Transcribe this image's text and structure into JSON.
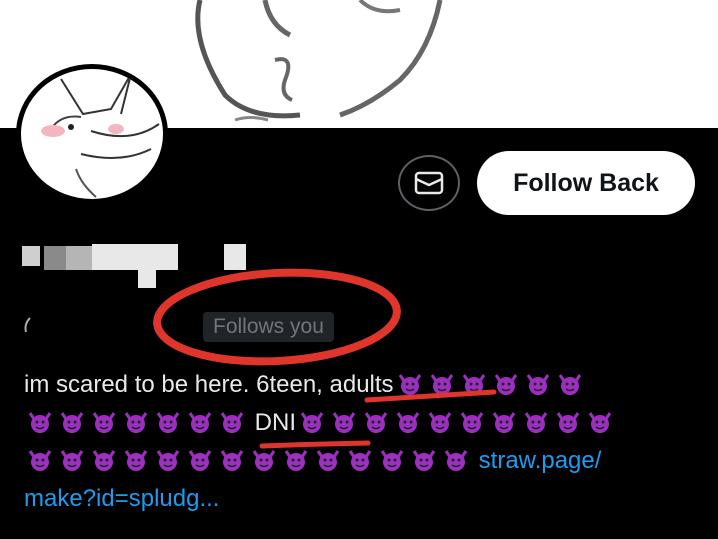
{
  "profile": {
    "follow_button_label": "Follow Back",
    "follows_you_label": "Follows you",
    "message_icon": "mail-icon"
  },
  "bio": {
    "text_part1": "im scared to be here. 6teen, ",
    "text_adults": "adults",
    "text_dni": "DNI",
    "link_part1": "straw.page/",
    "link_part2": "make?id=spludg..."
  },
  "colors": {
    "background": "#000000",
    "link": "#1d9bf0",
    "emoji": "#9b2fbf",
    "annotation_red": "#e0352b"
  }
}
